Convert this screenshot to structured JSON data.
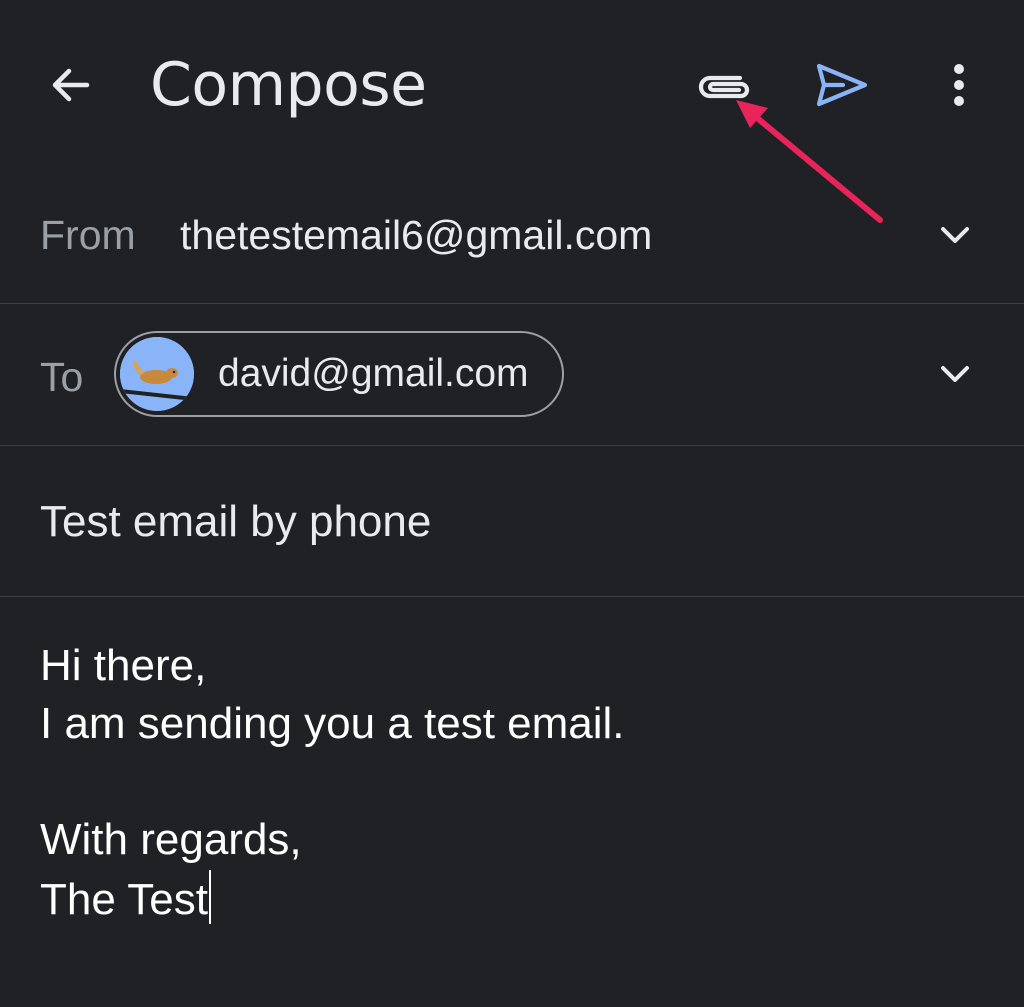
{
  "header": {
    "title": "Compose",
    "back_icon": "arrow-back-icon",
    "attach_icon": "paperclip-icon",
    "send_icon": "send-icon",
    "more_icon": "more-vert-icon"
  },
  "from": {
    "label": "From",
    "value": "thetestemail6@gmail.com"
  },
  "to": {
    "label": "To",
    "recipients": [
      {
        "email": "david@gmail.com"
      }
    ]
  },
  "subject": {
    "value": "Test email by phone"
  },
  "body": {
    "lines": [
      "Hi there,",
      "I am sending you a test email.",
      "",
      "With regards,",
      "The Test"
    ]
  },
  "colors": {
    "background": "#202124",
    "text": "#e8eaed",
    "secondary_text": "#9aa0a6",
    "send_accent": "#8ab4f8",
    "annotation_arrow": "#e8245a"
  }
}
